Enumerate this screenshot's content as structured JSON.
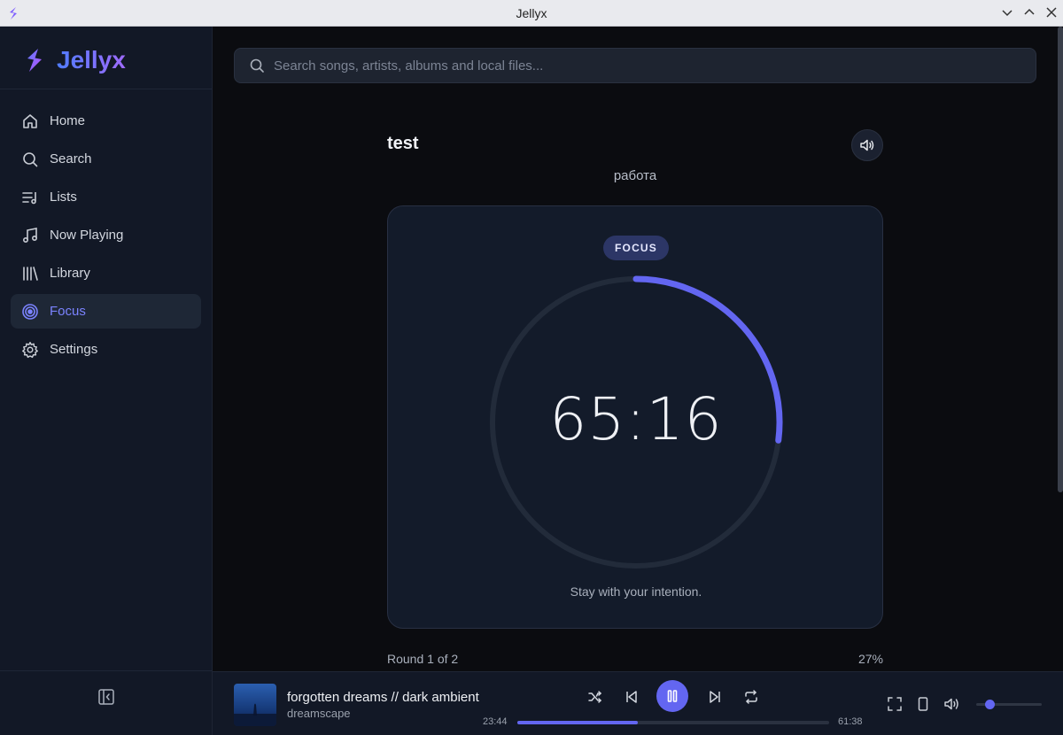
{
  "window": {
    "title": "Jellyx"
  },
  "brand": {
    "name": "Jellyx"
  },
  "sidebar": {
    "items": [
      {
        "label": "Home",
        "icon": "home-icon",
        "active": false
      },
      {
        "label": "Search",
        "icon": "search-icon",
        "active": false
      },
      {
        "label": "Lists",
        "icon": "playlist-icon",
        "active": false
      },
      {
        "label": "Now Playing",
        "icon": "music-note-icon",
        "active": false
      },
      {
        "label": "Library",
        "icon": "library-icon",
        "active": false
      },
      {
        "label": "Focus",
        "icon": "target-icon",
        "active": true
      },
      {
        "label": "Settings",
        "icon": "gear-icon",
        "active": false
      }
    ]
  },
  "search": {
    "placeholder": "Search songs, artists, albums and local files..."
  },
  "focus": {
    "title": "test",
    "subtitle": "работа",
    "mode_badge": "FOCUS",
    "timer": "65:16",
    "ring_progress": 0.27,
    "intention": "Stay with your intention.",
    "round_text": "Round 1 of 2",
    "percent_text": "27%"
  },
  "player": {
    "track_title": "forgotten dreams // dark ambient",
    "track_artist": "dreamscape",
    "time_current": "23:44",
    "time_total": "61:38",
    "progress": 0.385,
    "volume": 0.2,
    "state": "playing"
  },
  "colors": {
    "accent": "#6366f1",
    "sidebar_bg": "#121826",
    "main_bg": "#0b0c10",
    "card_bg": "#131b2a"
  }
}
